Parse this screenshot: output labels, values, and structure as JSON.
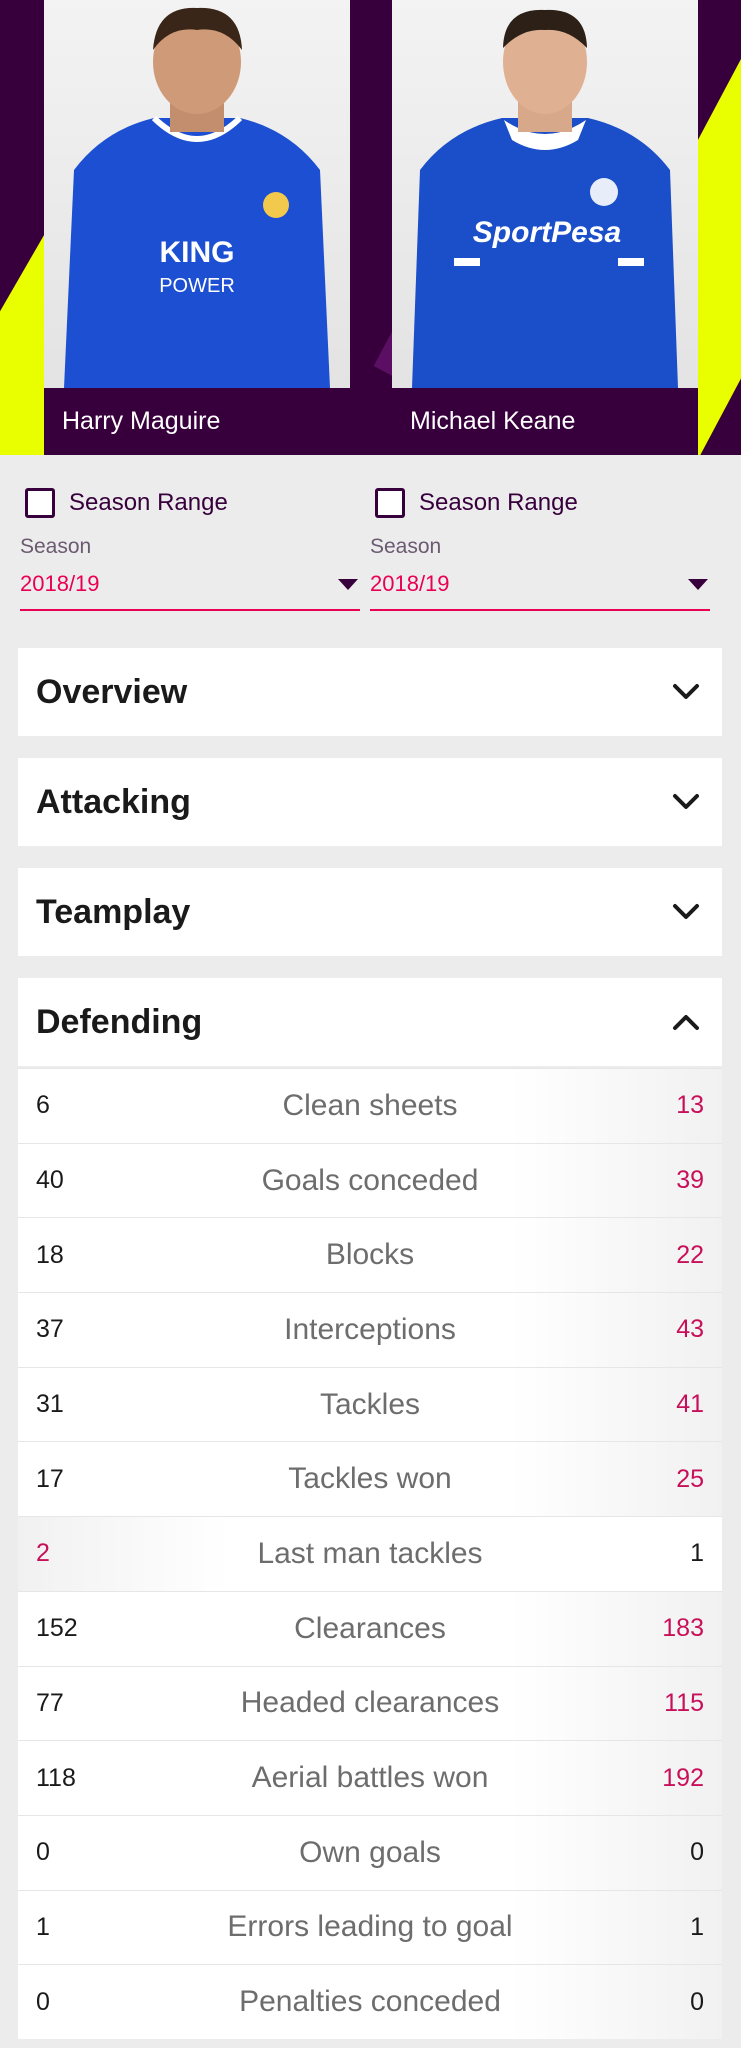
{
  "players": [
    {
      "name": "Harry Maguire"
    },
    {
      "name": "Michael Keane"
    }
  ],
  "selectors": [
    {
      "range_label": "Season Range",
      "season_label": "Season",
      "season_value": "2018/19"
    },
    {
      "range_label": "Season Range",
      "season_label": "Season",
      "season_value": "2018/19"
    }
  ],
  "sections": [
    {
      "title": "Overview",
      "state": "collapsed",
      "icon": "chevron-down-icon"
    },
    {
      "title": "Attacking",
      "state": "collapsed",
      "icon": "chevron-down-icon"
    },
    {
      "title": "Teamplay",
      "state": "collapsed",
      "icon": "chevron-down-icon"
    },
    {
      "title": "Defending",
      "state": "expanded",
      "icon": "chevron-up-icon"
    }
  ],
  "colors": {
    "accent": "#e90052",
    "brand": "#37003c",
    "highlight": "#e9ff00",
    "lead_value": "#c8105a"
  },
  "defending_stats": [
    {
      "label": "Clean sheets",
      "left": "6",
      "right": "13",
      "lead": "right"
    },
    {
      "label": "Goals conceded",
      "left": "40",
      "right": "39",
      "lead": "right"
    },
    {
      "label": "Blocks",
      "left": "18",
      "right": "22",
      "lead": "right"
    },
    {
      "label": "Interceptions",
      "left": "37",
      "right": "43",
      "lead": "right"
    },
    {
      "label": "Tackles",
      "left": "31",
      "right": "41",
      "lead": "right"
    },
    {
      "label": "Tackles won",
      "left": "17",
      "right": "25",
      "lead": "right"
    },
    {
      "label": "Last man tackles",
      "left": "2",
      "right": "1",
      "lead": "left"
    },
    {
      "label": "Clearances",
      "left": "152",
      "right": "183",
      "lead": "right"
    },
    {
      "label": "Headed clearances",
      "left": "77",
      "right": "115",
      "lead": "right"
    },
    {
      "label": "Aerial battles won",
      "left": "118",
      "right": "192",
      "lead": "right"
    },
    {
      "label": "Own goals",
      "left": "0",
      "right": "0",
      "lead": "none"
    },
    {
      "label": "Errors leading to goal",
      "left": "1",
      "right": "1",
      "lead": "none"
    },
    {
      "label": "Penalties conceded",
      "left": "0",
      "right": "0",
      "lead": "none"
    }
  ]
}
